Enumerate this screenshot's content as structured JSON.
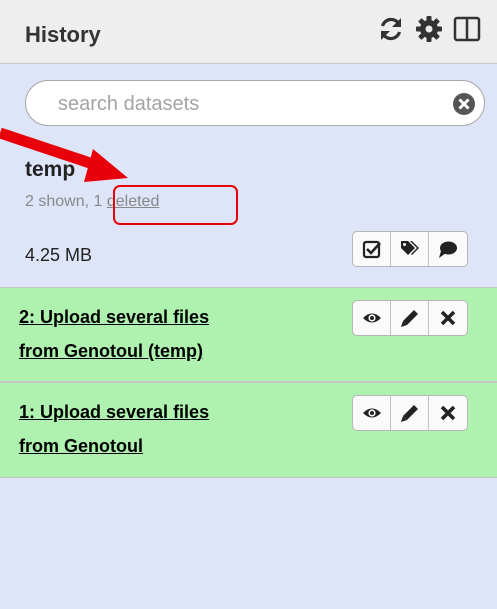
{
  "header": {
    "title": "History",
    "icons": [
      "refresh-icon",
      "gear-icon",
      "columns-icon"
    ]
  },
  "search": {
    "placeholder": "search datasets",
    "value": ""
  },
  "history": {
    "name": "temp",
    "shown_text": "2 shown, ",
    "deleted_count": "1",
    "deleted_label": "deleted",
    "size": "4.25 MB"
  },
  "history_actions": [
    "checkbox-icon",
    "tags-icon",
    "comment-icon"
  ],
  "datasets": [
    {
      "hid_title_line1": "2: Upload several files",
      "hid_title_line2": "from Genotoul (temp)",
      "actions": [
        "eye-icon",
        "pencil-icon",
        "delete-icon"
      ]
    },
    {
      "hid_title_line1": "1: Upload several files",
      "hid_title_line2": "from Genotoul",
      "actions": [
        "eye-icon",
        "pencil-icon",
        "delete-icon"
      ]
    }
  ],
  "colors": {
    "panel_bg": "#dfe5f9",
    "dataset_ok_bg": "#aff1af",
    "annotation_red": "#e8000b"
  }
}
